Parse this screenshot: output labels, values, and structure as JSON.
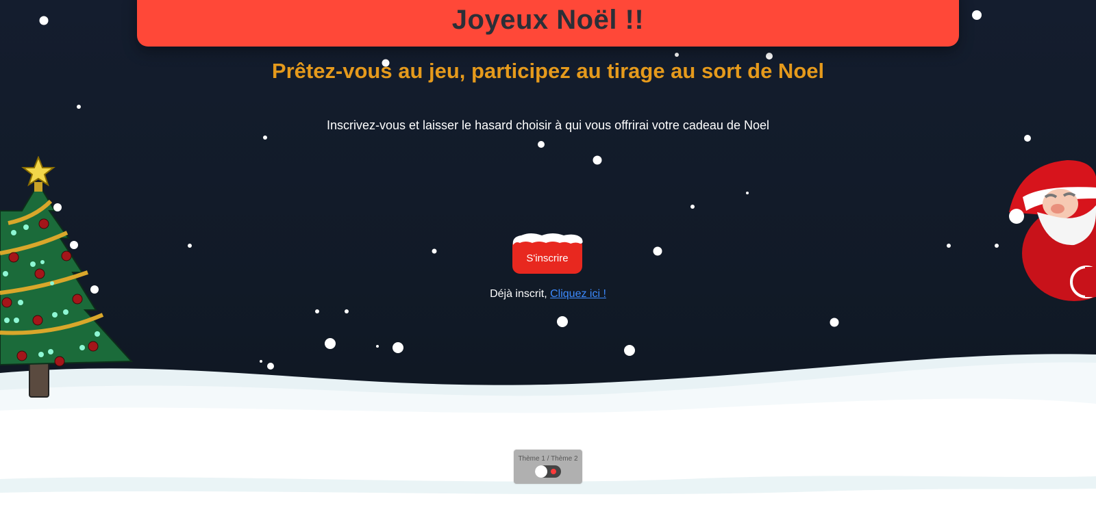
{
  "header": {
    "title": "Joyeux Noël !!"
  },
  "main": {
    "subtitle": "Prêtez-vous au jeu, participez au tirage au sort de Noel",
    "intro": "Inscrivez-vous et laisser le hasard choisir à qui vous offrirai votre cadeau de Noel",
    "register_label": "S'inscrire",
    "login_prefix": "Déjà inscrit,",
    "login_link": "Cliquez ici !"
  },
  "theme": {
    "label": "Thème 1 / Thème 2"
  },
  "colors": {
    "banner": "#ff4838",
    "title_text": "#2b2f37",
    "subtitle": "#e59a1c",
    "button": "#e8281f",
    "link": "#3d8bff",
    "background": "#141d2e"
  },
  "icons": [
    "christmas-tree-icon",
    "santa-claus-icon",
    "snowflake-icon"
  ]
}
